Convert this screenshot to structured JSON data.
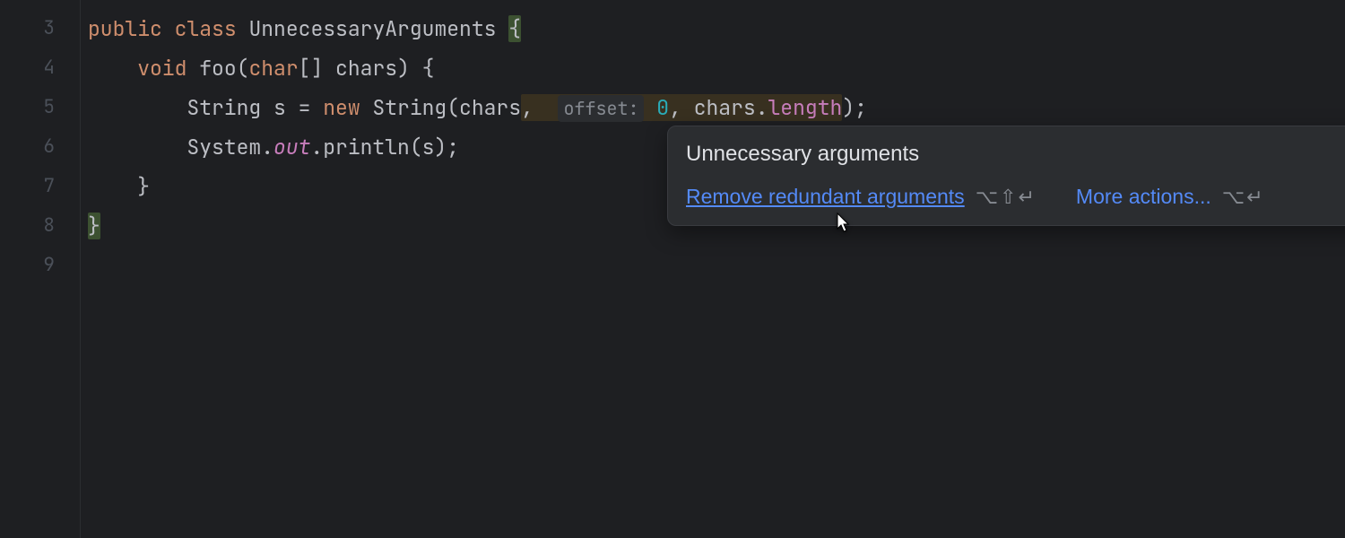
{
  "gutter": {
    "lines": [
      "3",
      "4",
      "5",
      "6",
      "7",
      "8",
      "9"
    ]
  },
  "code": {
    "l3": {
      "kw1": "public",
      "kw2": "class",
      "name": "UnnecessaryArguments",
      "brace": "{"
    },
    "l4": {
      "kw1": "void",
      "fn": "foo",
      "p1": "(",
      "kw2": "char",
      "arr": "[]",
      "arg": " chars",
      "p2": ")",
      "brace": " {"
    },
    "l5": {
      "t1": "String s = ",
      "kw": "new",
      "t2": " String(chars",
      "c1": ",",
      "hint": "offset:",
      "num": "0",
      "c2": ",",
      "t3": " chars.",
      "prop": "length",
      "t4": ");"
    },
    "l6": {
      "t1": "System.",
      "out": "out",
      "t2": ".println(s);"
    },
    "l7": {
      "brace": "}"
    },
    "l8": {
      "brace": "}"
    }
  },
  "popup": {
    "title": "Unnecessary arguments",
    "action1": "Remove redundant arguments",
    "shortcut1": "⌥⇧↵",
    "action2": "More actions...",
    "shortcut2": "⌥↵"
  }
}
